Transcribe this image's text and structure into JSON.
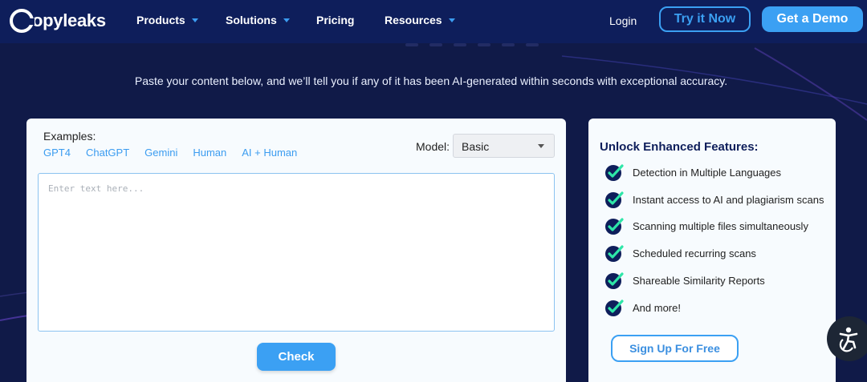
{
  "brand": {
    "name": "Copyleaks",
    "logo_letter": "C",
    "logo_rest": "opyleaks"
  },
  "nav": {
    "items": [
      {
        "label": "Products",
        "has_caret": true
      },
      {
        "label": "Solutions",
        "has_caret": true
      },
      {
        "label": "Pricing",
        "has_caret": false
      },
      {
        "label": "Resources",
        "has_caret": true
      }
    ],
    "login_label": "Login",
    "try_label": "Try it Now",
    "demo_label": "Get a Demo"
  },
  "tagline": "Paste your content below, and we’ll tell you if any of it has been AI-generated within seconds with exceptional accuracy.",
  "checker": {
    "examples_label": "Examples:",
    "examples": [
      "GPT4",
      "ChatGPT",
      "Gemini",
      "Human",
      "AI + Human"
    ],
    "model_label": "Model:",
    "model_value": "Basic",
    "textarea_placeholder": "Enter text here...",
    "check_label": "Check"
  },
  "features": {
    "title": "Unlock Enhanced Features:",
    "items": [
      "Detection in Multiple Languages",
      "Instant access to AI and plagiarism scans",
      "Scanning multiple files simultaneously",
      "Scheduled recurring scans",
      "Shareable Similarity Reports",
      "And more!"
    ],
    "signup_label": "Sign Up For Free"
  },
  "colors": {
    "nav_bg": "#0e1e5b",
    "page_bg": "#101a48",
    "accent": "#3ba0f3",
    "check_green": "#2ee6a8",
    "check_navy": "#0e1e5b"
  }
}
